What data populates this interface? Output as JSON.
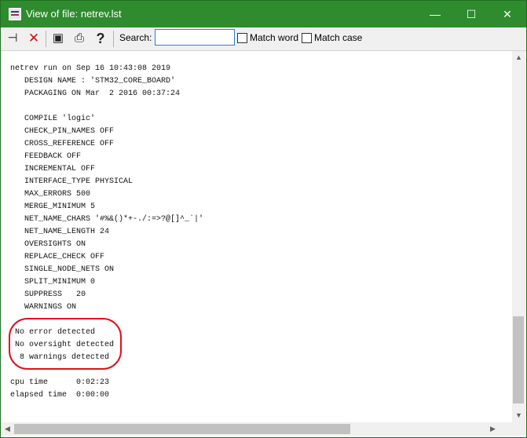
{
  "window": {
    "title": "View of file: netrev.lst",
    "minimize_glyph": "—",
    "maximize_glyph": "☐",
    "close_glyph": "✕"
  },
  "toolbar": {
    "icons": [
      "pin-icon",
      "delete-icon",
      "save-icon",
      "print-icon",
      "help-icon"
    ],
    "pin_glyph": "⊣",
    "delete_glyph": "✕",
    "save_glyph": "▣",
    "print_glyph": "⎙",
    "help_glyph": "?",
    "search_label": "Search:",
    "search_value": "",
    "match_word_label": "Match word",
    "match_case_label": "Match case"
  },
  "log": {
    "lines": [
      "netrev run on Sep 16 10:43:08 2019",
      "   DESIGN NAME : 'STM32_CORE_BOARD'",
      "   PACKAGING ON Mar  2 2016 00:37:24",
      "",
      "   COMPILE 'logic'",
      "   CHECK_PIN_NAMES OFF",
      "   CROSS_REFERENCE OFF",
      "   FEEDBACK OFF",
      "   INCREMENTAL OFF",
      "   INTERFACE_TYPE PHYSICAL",
      "   MAX_ERRORS 500",
      "   MERGE_MINIMUM 5",
      "   NET_NAME_CHARS '#%&()*+-./:=>?@[]^_`|'",
      "   NET_NAME_LENGTH 24",
      "   OVERSIGHTS ON",
      "   REPLACE_CHECK OFF",
      "   SINGLE_NODE_NETS ON",
      "   SPLIT_MINIMUM 0",
      "   SUPPRESS   20",
      "   WARNINGS ON",
      "",
      " No error detected",
      " No oversight detected",
      "  8 warnings detected",
      "",
      "cpu time      0:02:23",
      "elapsed time  0:00:00"
    ]
  },
  "scrollbars": {
    "up_glyph": "▲",
    "down_glyph": "▼",
    "left_glyph": "◀",
    "right_glyph": "▶"
  },
  "colors": {
    "titlebar": "#2e8b2e",
    "annotation_circle": "#e0101b"
  }
}
